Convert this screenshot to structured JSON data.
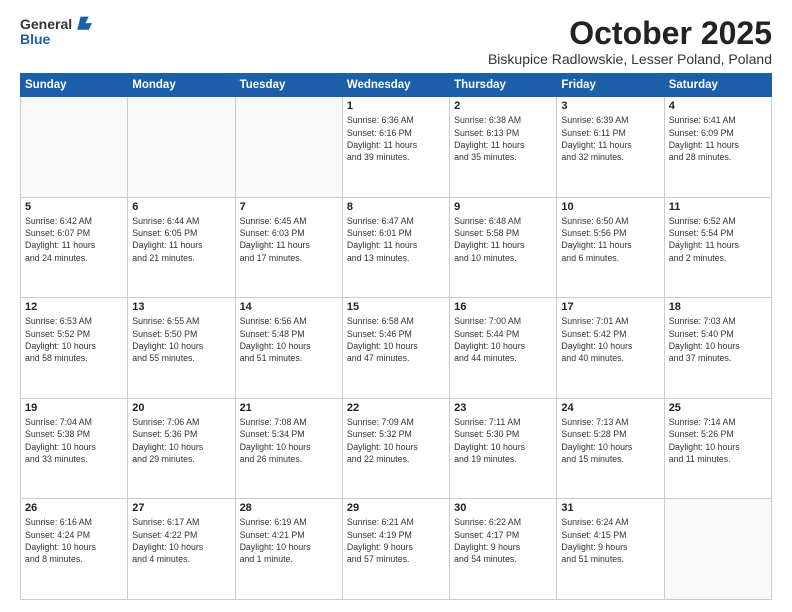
{
  "header": {
    "logo_general": "General",
    "logo_blue": "Blue",
    "month": "October 2025",
    "location": "Biskupice Radlowskie, Lesser Poland, Poland"
  },
  "days_of_week": [
    "Sunday",
    "Monday",
    "Tuesday",
    "Wednesday",
    "Thursday",
    "Friday",
    "Saturday"
  ],
  "weeks": [
    [
      {
        "day": "",
        "text": ""
      },
      {
        "day": "",
        "text": ""
      },
      {
        "day": "",
        "text": ""
      },
      {
        "day": "1",
        "text": "Sunrise: 6:36 AM\nSunset: 6:16 PM\nDaylight: 11 hours\nand 39 minutes."
      },
      {
        "day": "2",
        "text": "Sunrise: 6:38 AM\nSunset: 6:13 PM\nDaylight: 11 hours\nand 35 minutes."
      },
      {
        "day": "3",
        "text": "Sunrise: 6:39 AM\nSunset: 6:11 PM\nDaylight: 11 hours\nand 32 minutes."
      },
      {
        "day": "4",
        "text": "Sunrise: 6:41 AM\nSunset: 6:09 PM\nDaylight: 11 hours\nand 28 minutes."
      }
    ],
    [
      {
        "day": "5",
        "text": "Sunrise: 6:42 AM\nSunset: 6:07 PM\nDaylight: 11 hours\nand 24 minutes."
      },
      {
        "day": "6",
        "text": "Sunrise: 6:44 AM\nSunset: 6:05 PM\nDaylight: 11 hours\nand 21 minutes."
      },
      {
        "day": "7",
        "text": "Sunrise: 6:45 AM\nSunset: 6:03 PM\nDaylight: 11 hours\nand 17 minutes."
      },
      {
        "day": "8",
        "text": "Sunrise: 6:47 AM\nSunset: 6:01 PM\nDaylight: 11 hours\nand 13 minutes."
      },
      {
        "day": "9",
        "text": "Sunrise: 6:48 AM\nSunset: 5:58 PM\nDaylight: 11 hours\nand 10 minutes."
      },
      {
        "day": "10",
        "text": "Sunrise: 6:50 AM\nSunset: 5:56 PM\nDaylight: 11 hours\nand 6 minutes."
      },
      {
        "day": "11",
        "text": "Sunrise: 6:52 AM\nSunset: 5:54 PM\nDaylight: 11 hours\nand 2 minutes."
      }
    ],
    [
      {
        "day": "12",
        "text": "Sunrise: 6:53 AM\nSunset: 5:52 PM\nDaylight: 10 hours\nand 58 minutes."
      },
      {
        "day": "13",
        "text": "Sunrise: 6:55 AM\nSunset: 5:50 PM\nDaylight: 10 hours\nand 55 minutes."
      },
      {
        "day": "14",
        "text": "Sunrise: 6:56 AM\nSunset: 5:48 PM\nDaylight: 10 hours\nand 51 minutes."
      },
      {
        "day": "15",
        "text": "Sunrise: 6:58 AM\nSunset: 5:46 PM\nDaylight: 10 hours\nand 47 minutes."
      },
      {
        "day": "16",
        "text": "Sunrise: 7:00 AM\nSunset: 5:44 PM\nDaylight: 10 hours\nand 44 minutes."
      },
      {
        "day": "17",
        "text": "Sunrise: 7:01 AM\nSunset: 5:42 PM\nDaylight: 10 hours\nand 40 minutes."
      },
      {
        "day": "18",
        "text": "Sunrise: 7:03 AM\nSunset: 5:40 PM\nDaylight: 10 hours\nand 37 minutes."
      }
    ],
    [
      {
        "day": "19",
        "text": "Sunrise: 7:04 AM\nSunset: 5:38 PM\nDaylight: 10 hours\nand 33 minutes."
      },
      {
        "day": "20",
        "text": "Sunrise: 7:06 AM\nSunset: 5:36 PM\nDaylight: 10 hours\nand 29 minutes."
      },
      {
        "day": "21",
        "text": "Sunrise: 7:08 AM\nSunset: 5:34 PM\nDaylight: 10 hours\nand 26 minutes."
      },
      {
        "day": "22",
        "text": "Sunrise: 7:09 AM\nSunset: 5:32 PM\nDaylight: 10 hours\nand 22 minutes."
      },
      {
        "day": "23",
        "text": "Sunrise: 7:11 AM\nSunset: 5:30 PM\nDaylight: 10 hours\nand 19 minutes."
      },
      {
        "day": "24",
        "text": "Sunrise: 7:13 AM\nSunset: 5:28 PM\nDaylight: 10 hours\nand 15 minutes."
      },
      {
        "day": "25",
        "text": "Sunrise: 7:14 AM\nSunset: 5:26 PM\nDaylight: 10 hours\nand 11 minutes."
      }
    ],
    [
      {
        "day": "26",
        "text": "Sunrise: 6:16 AM\nSunset: 4:24 PM\nDaylight: 10 hours\nand 8 minutes."
      },
      {
        "day": "27",
        "text": "Sunrise: 6:17 AM\nSunset: 4:22 PM\nDaylight: 10 hours\nand 4 minutes."
      },
      {
        "day": "28",
        "text": "Sunrise: 6:19 AM\nSunset: 4:21 PM\nDaylight: 10 hours\nand 1 minute."
      },
      {
        "day": "29",
        "text": "Sunrise: 6:21 AM\nSunset: 4:19 PM\nDaylight: 9 hours\nand 57 minutes."
      },
      {
        "day": "30",
        "text": "Sunrise: 6:22 AM\nSunset: 4:17 PM\nDaylight: 9 hours\nand 54 minutes."
      },
      {
        "day": "31",
        "text": "Sunrise: 6:24 AM\nSunset: 4:15 PM\nDaylight: 9 hours\nand 51 minutes."
      },
      {
        "day": "",
        "text": ""
      }
    ]
  ]
}
